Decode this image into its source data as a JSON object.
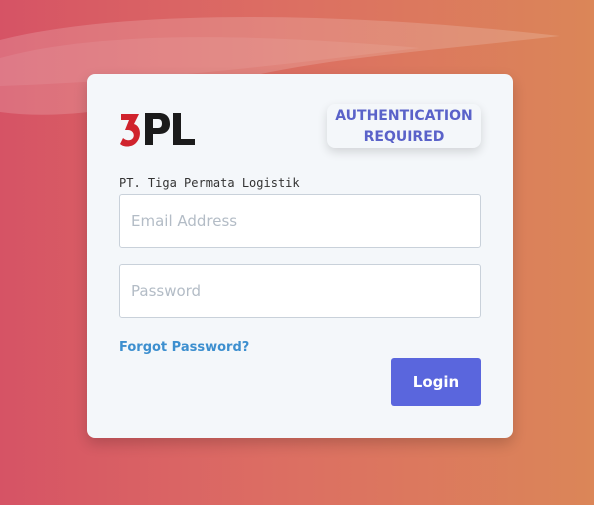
{
  "logo": {
    "text": "3PL",
    "digit_color": "#d0232d",
    "letters_color": "#1b1b1b"
  },
  "auth_badge": {
    "line1": "AUTHENTICATION",
    "line2": "REQUIRED"
  },
  "company": {
    "name": "PT. Tiga Permata Logistik"
  },
  "form": {
    "email_placeholder": "Email Address",
    "password_placeholder": "Password",
    "forgot_label": "Forgot Password?",
    "login_label": "Login"
  },
  "colors": {
    "accent": "#5a66dd",
    "link": "#3d8fcf",
    "badge_text": "#5a62c9"
  }
}
